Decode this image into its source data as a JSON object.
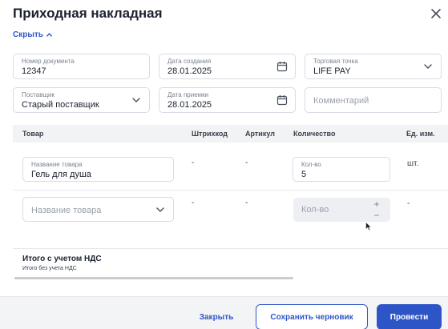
{
  "header": {
    "title": "Приходная накладная",
    "collapse_label": "Скрыть"
  },
  "form": {
    "doc_number": {
      "label": "Номер документа",
      "value": "12347"
    },
    "created_date": {
      "label": "Дата создания",
      "value": "28.01.2025"
    },
    "trade_point": {
      "label": "Торговая точка",
      "value": "LIFE PAY"
    },
    "supplier": {
      "label": "Поставщик",
      "value": "Старый поставщик"
    },
    "received_date": {
      "label": "Дата приемки",
      "value": "28.01.2025"
    },
    "comment": {
      "placeholder": "Комментарий"
    }
  },
  "table": {
    "columns": [
      "Товар",
      "Штрихкод",
      "Артикул",
      "Количество",
      "Ед. изм."
    ],
    "rows": [
      {
        "product_label": "Название товара",
        "product_value": "Гель для душа",
        "barcode": "-",
        "article": "-",
        "qty_label": "Кол-во",
        "qty_value": "5",
        "unit": "шт."
      },
      {
        "product_placeholder": "Название товара",
        "barcode": "-",
        "article": "-",
        "qty_placeholder": "Кол-во",
        "qty_plus": "+",
        "qty_minus": "−",
        "unit": "-"
      }
    ]
  },
  "totals": {
    "with_vat": "Итого с учетом НДС",
    "without_vat": "Итого без учета НДС"
  },
  "footer": {
    "close_label": "Закрыть",
    "save_draft_label": "Сохранить черновик",
    "post_label": "Провести"
  },
  "colors": {
    "accent": "#2d55c7",
    "border": "#d7dbe3",
    "table_header_bg": "#f2f3f5",
    "footer_bg": "#f3f4f6"
  }
}
